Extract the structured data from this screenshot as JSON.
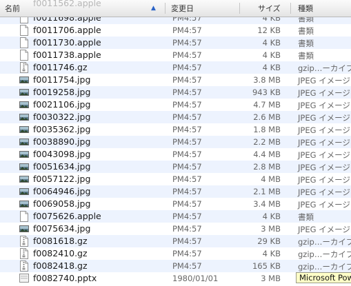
{
  "header": {
    "scrolled_row_name": "f0011562.apple",
    "columns": {
      "name": "名前",
      "date": "変更日",
      "size": "サイズ",
      "kind": "種類"
    },
    "sort_indicator": "▲"
  },
  "rows": [
    {
      "name": "f0011698.apple",
      "date": "PM4:57",
      "size": "4 KB",
      "kind": "書類",
      "icon": "document-icon"
    },
    {
      "name": "f0011706.apple",
      "date": "PM4:57",
      "size": "12 KB",
      "kind": "書類",
      "icon": "document-icon"
    },
    {
      "name": "f0011730.apple",
      "date": "PM4:57",
      "size": "4 KB",
      "kind": "書類",
      "icon": "document-icon"
    },
    {
      "name": "f0011738.apple",
      "date": "PM4:57",
      "size": "4 KB",
      "kind": "書類",
      "icon": "document-icon"
    },
    {
      "name": "f0011746.gz",
      "date": "PM4:57",
      "size": "4 KB",
      "kind": "gzip…ーカイブ",
      "icon": "archive-icon"
    },
    {
      "name": "f0011754.jpg",
      "date": "PM4:57",
      "size": "3.8 MB",
      "kind": "JPEG イメージ",
      "icon": "image-thumbnail-icon"
    },
    {
      "name": "f0019258.jpg",
      "date": "PM4:57",
      "size": "943 KB",
      "kind": "JPEG イメージ",
      "icon": "image-thumbnail-icon"
    },
    {
      "name": "f0021106.jpg",
      "date": "PM4:57",
      "size": "4.7 MB",
      "kind": "JPEG イメージ",
      "icon": "image-thumbnail-icon"
    },
    {
      "name": "f0030322.jpg",
      "date": "PM4:57",
      "size": "2.6 MB",
      "kind": "JPEG イメージ",
      "icon": "image-thumbnail-icon"
    },
    {
      "name": "f0035362.jpg",
      "date": "PM4:57",
      "size": "1.8 MB",
      "kind": "JPEG イメージ",
      "icon": "image-thumbnail-icon"
    },
    {
      "name": "f0038890.jpg",
      "date": "PM4:57",
      "size": "2.2 MB",
      "kind": "JPEG イメージ",
      "icon": "image-thumbnail-icon"
    },
    {
      "name": "f0043098.jpg",
      "date": "PM4:57",
      "size": "4.4 MB",
      "kind": "JPEG イメージ",
      "icon": "image-thumbnail-icon"
    },
    {
      "name": "f0051634.jpg",
      "date": "PM4:57",
      "size": "2.8 MB",
      "kind": "JPEG イメージ",
      "icon": "image-thumbnail-icon"
    },
    {
      "name": "f0057122.jpg",
      "date": "PM4:57",
      "size": "4 MB",
      "kind": "JPEG イメージ",
      "icon": "image-thumbnail-icon"
    },
    {
      "name": "f0064946.jpg",
      "date": "PM4:57",
      "size": "2.1 MB",
      "kind": "JPEG イメージ",
      "icon": "image-thumbnail-icon"
    },
    {
      "name": "f0069058.jpg",
      "date": "PM4:57",
      "size": "3.4 MB",
      "kind": "JPEG イメージ",
      "icon": "image-thumbnail-icon"
    },
    {
      "name": "f0075626.apple",
      "date": "PM4:57",
      "size": "4 KB",
      "kind": "書類",
      "icon": "document-icon"
    },
    {
      "name": "f0075634.jpg",
      "date": "PM4:57",
      "size": "3 MB",
      "kind": "JPEG イメージ",
      "icon": "image-thumbnail-icon"
    },
    {
      "name": "f0081618.gz",
      "date": "PM4:57",
      "size": "29 KB",
      "kind": "gzip…ーカイブ",
      "icon": "archive-icon"
    },
    {
      "name": "f0082410.gz",
      "date": "PM4:57",
      "size": "4 KB",
      "kind": "gzip…ーカイブ",
      "icon": "archive-icon"
    },
    {
      "name": "f0082418.gz",
      "date": "PM4:57",
      "size": "165 KB",
      "kind": "gzip…ーカイブ",
      "icon": "archive-icon"
    },
    {
      "name": "f0082740.pptx",
      "date": "1980/01/01",
      "size": "3 MB",
      "kind": "",
      "icon": "presentation-icon"
    }
  ],
  "tooltip": {
    "text": "Microsoft Pow"
  },
  "colors": {
    "row_alt": "#edf3fe",
    "sort_arrow": "#2a63c7",
    "tooltip_bg": "#ffffc7"
  }
}
